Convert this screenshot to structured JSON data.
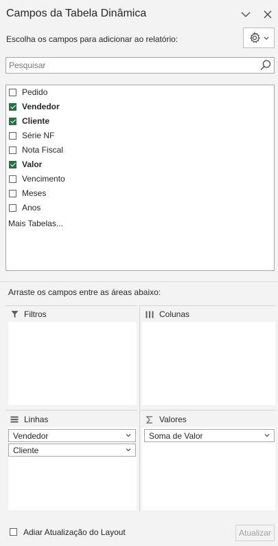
{
  "panel": {
    "title": "Campos da Tabela Dinâmica",
    "subtitle": "Escolha os campos para adicionar ao relatório:"
  },
  "search": {
    "placeholder": "Pesquisar",
    "value": ""
  },
  "fields": [
    {
      "label": "Pedido",
      "checked": false
    },
    {
      "label": "Vendedor",
      "checked": true
    },
    {
      "label": "Cliente",
      "checked": true
    },
    {
      "label": "Série NF",
      "checked": false
    },
    {
      "label": "Nota Fiscal",
      "checked": false
    },
    {
      "label": "Valor",
      "checked": true
    },
    {
      "label": "Vencimento",
      "checked": false
    },
    {
      "label": "Meses",
      "checked": false
    },
    {
      "label": "Anos",
      "checked": false
    }
  ],
  "more_tables": "Mais Tabelas...",
  "drag_hint": "Arraste os campos entre as áreas abaixo:",
  "areas": {
    "filters": {
      "title": "Filtros",
      "items": []
    },
    "columns": {
      "title": "Colunas",
      "items": []
    },
    "rows": {
      "title": "Linhas",
      "items": [
        "Vendedor",
        "Cliente"
      ]
    },
    "values": {
      "title": "Valores",
      "items": [
        "Soma de Valor"
      ]
    }
  },
  "footer": {
    "defer_label": "Adiar Atualização do Layout",
    "defer_checked": false,
    "update_label": "Atualizar"
  },
  "icons": {
    "collapse": "chevron-down-icon",
    "close": "close-icon",
    "settings": "gear-icon",
    "search": "search-icon",
    "filter": "filter-icon",
    "columns": "columns-icon",
    "rows": "rows-icon",
    "values": "sigma-icon"
  },
  "colors": {
    "check": "#217346",
    "background": "#f3f3f3"
  }
}
